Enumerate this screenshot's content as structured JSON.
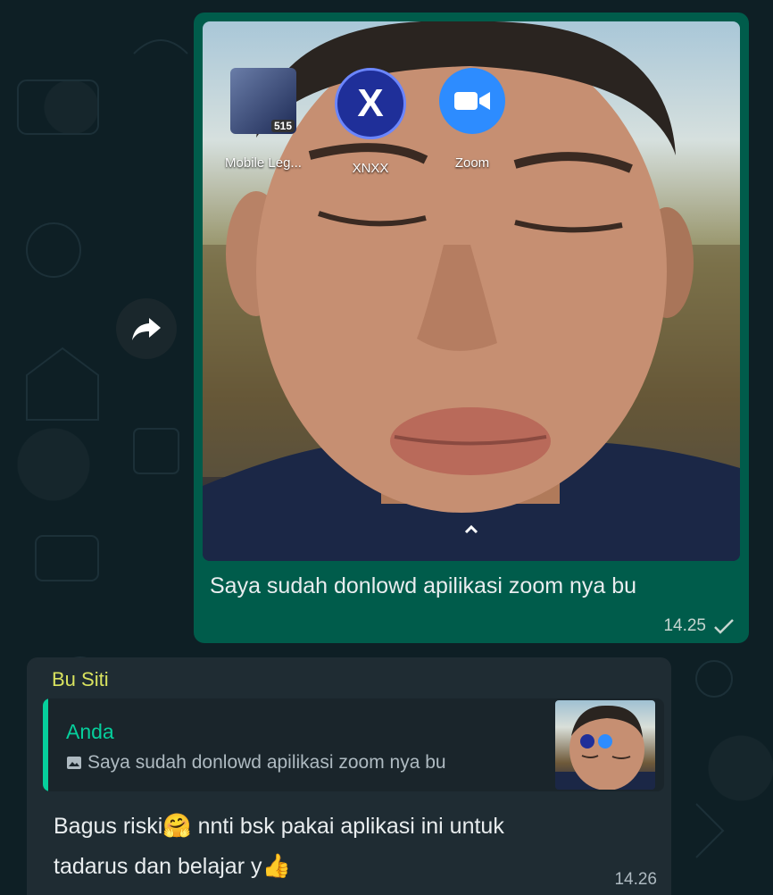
{
  "home_apps": [
    {
      "label": "Mobile Leg...",
      "icon": "mobile-legends-app-icon",
      "badge": "515"
    },
    {
      "label": "XNXX",
      "icon": "x-app-icon"
    },
    {
      "label": "Zoom",
      "icon": "zoom-video-icon"
    }
  ],
  "outgoing": {
    "caption": "Saya sudah donlowd apilikasi zoom nya bu",
    "time": "14.25",
    "status_icon": "check-icon"
  },
  "incoming": {
    "sender": "Bu Siti",
    "quoted_author": "Anda",
    "quoted_text": "Saya sudah donlowd apilikasi zoom nya bu",
    "quoted_icon": "photo-icon",
    "text_line1": "Bagus riski",
    "text_line1_rest": " nnti bsk pakai aplikasi ini untuk",
    "text_line2": "tadarus dan belajar y",
    "emoji_hug": "🤗",
    "emoji_thumb": "👍",
    "time": "14.26"
  },
  "colors": {
    "outgoing_bubble": "#005c4b",
    "incoming_bubble": "#1f2c33",
    "sender_name": "#d9e35f",
    "quote_accent": "#06cf9c"
  }
}
